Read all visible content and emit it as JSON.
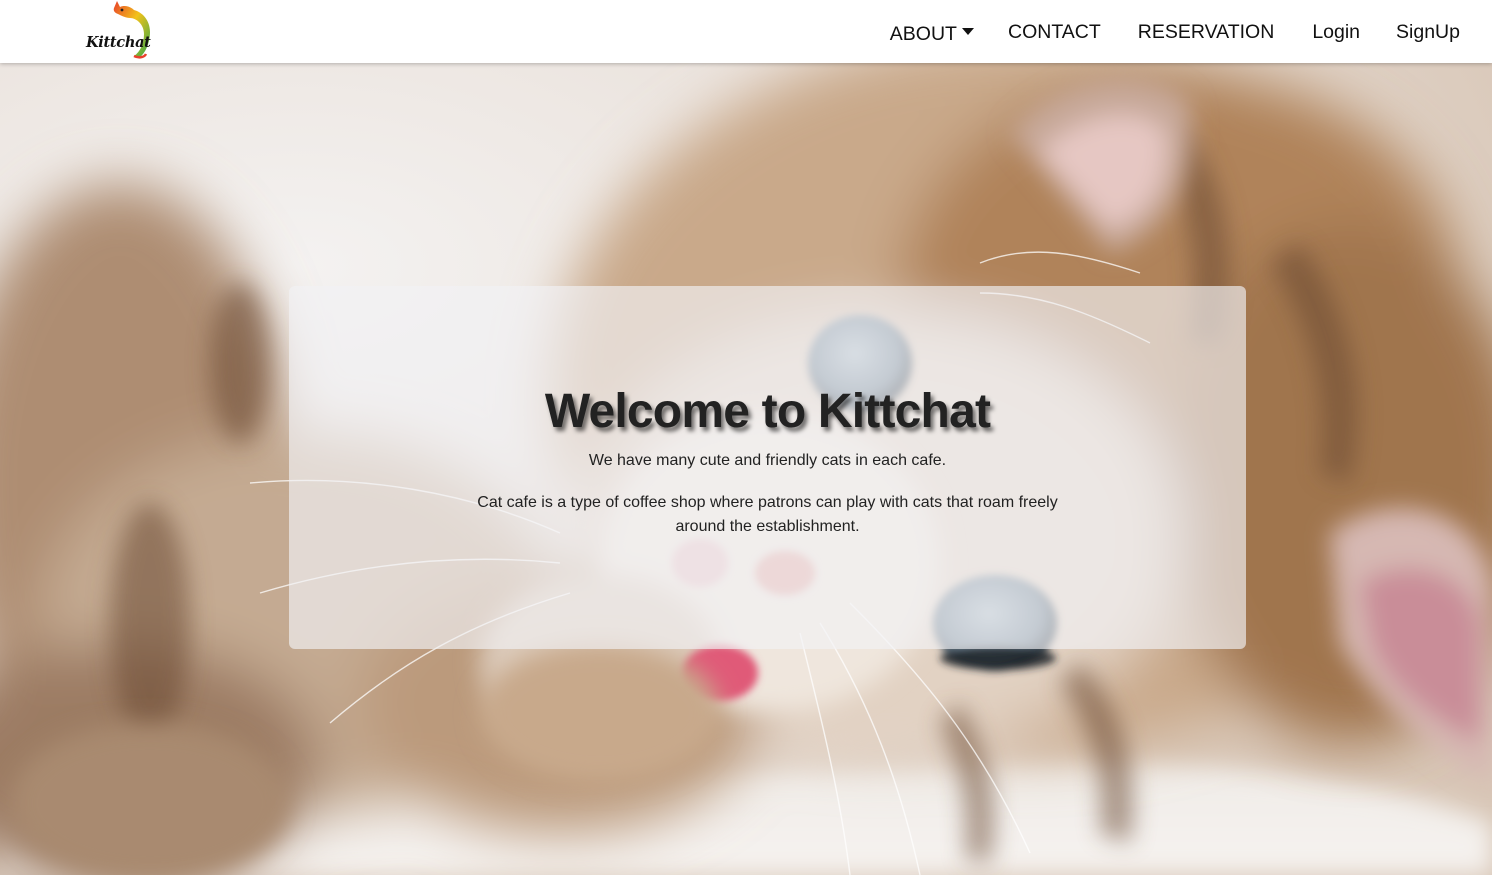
{
  "brand": {
    "name": "Kittchat"
  },
  "nav": {
    "items": [
      {
        "label": "ABOUT",
        "has_dropdown": true
      },
      {
        "label": "CONTACT"
      },
      {
        "label": "RESERVATION"
      },
      {
        "label": "Login"
      },
      {
        "label": "SignUp"
      }
    ]
  },
  "hero": {
    "background_image": "kitten-photo",
    "card": {
      "title": "Welcome to Kittchat",
      "subtitle": "We have many cute and friendly cats in each cafe.",
      "description": "Cat cafe is a type of coffee shop where patrons can play with cats that roam freely around the establishment."
    }
  },
  "colors": {
    "nav_background": "#ffffff",
    "nav_text": "#111111",
    "card_background": "rgba(242,242,244,0.66)",
    "title_text": "#222222"
  },
  "icons": {
    "logo": "cat-silhouette-icon",
    "dropdown": "caret-down-icon"
  }
}
